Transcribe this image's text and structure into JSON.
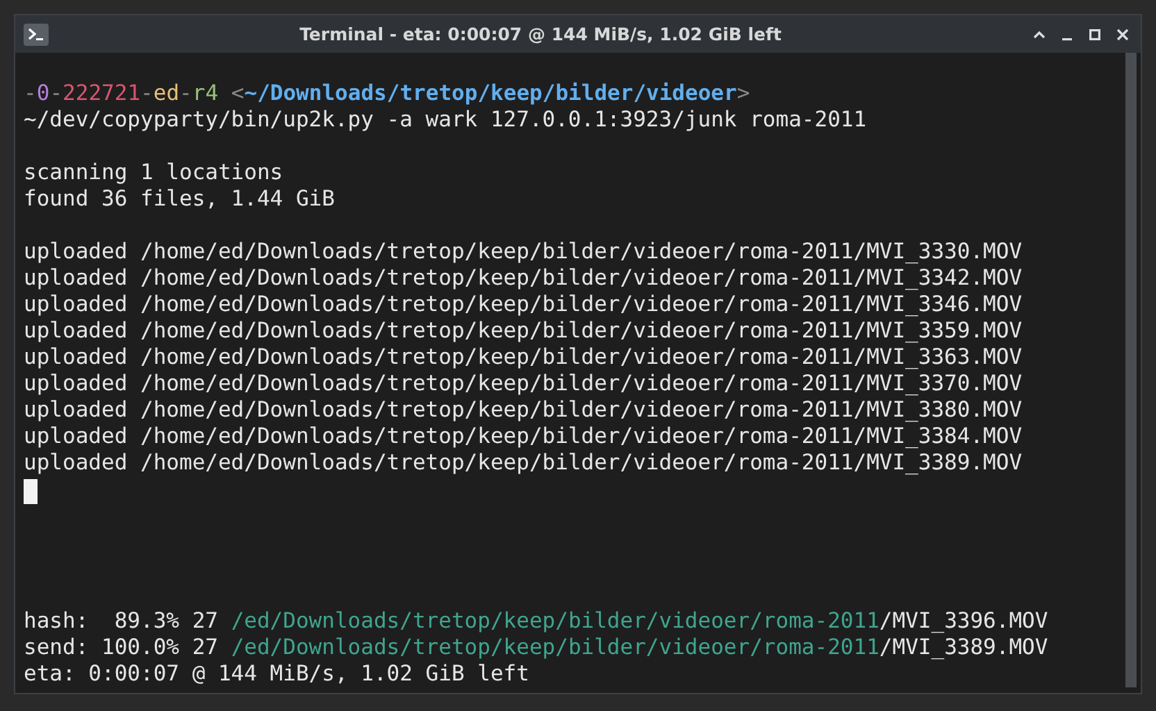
{
  "window": {
    "title": "Terminal - eta: 0:00:07 @ 144 MiB/s, 1.02 GiB left"
  },
  "blocks": [
    [
      [
        {
          "text": "-",
          "color": "#8a8a8a"
        },
        {
          "text": "0",
          "color": "#b57edc"
        },
        {
          "text": "-",
          "color": "#8a8a8a"
        },
        {
          "text": "222721",
          "color": "#d9566e"
        },
        {
          "text": "-",
          "color": "#8a8a8a"
        },
        {
          "text": "ed",
          "color": "#e5c07b"
        },
        {
          "text": "-",
          "color": "#8a8a8a"
        },
        {
          "text": "r4",
          "color": "#98c379"
        },
        {
          "text": " <",
          "color": "#8a8a8a"
        },
        {
          "text": "~/Downloads/tretop/keep/bilder/videoer",
          "color": "#61afef"
        },
        {
          "text": ">",
          "color": "#8a8a8a"
        }
      ],
      [
        {
          "text": "~/dev/copyparty/bin/up2k.py -a wark 127.0.0.1:3923/junk roma-2011",
          "color": "#e6e6e6"
        }
      ]
    ],
    [
      [
        {
          "text": "scanning 1 locations",
          "color": "#e6e6e6"
        }
      ],
      [
        {
          "text": "found 36 files, 1.44 GiB",
          "color": "#e6e6e6"
        }
      ]
    ],
    [
      [
        {
          "text": "uploaded /home/ed/Downloads/tretop/keep/bilder/videoer/roma-2011/MVI_3330.MOV",
          "color": "#e6e6e6"
        }
      ],
      [
        {
          "text": "uploaded /home/ed/Downloads/tretop/keep/bilder/videoer/roma-2011/MVI_3342.MOV",
          "color": "#e6e6e6"
        }
      ],
      [
        {
          "text": "uploaded /home/ed/Downloads/tretop/keep/bilder/videoer/roma-2011/MVI_3346.MOV",
          "color": "#e6e6e6"
        }
      ],
      [
        {
          "text": "uploaded /home/ed/Downloads/tretop/keep/bilder/videoer/roma-2011/MVI_3359.MOV",
          "color": "#e6e6e6"
        }
      ],
      [
        {
          "text": "uploaded /home/ed/Downloads/tretop/keep/bilder/videoer/roma-2011/MVI_3363.MOV",
          "color": "#e6e6e6"
        }
      ],
      [
        {
          "text": "uploaded /home/ed/Downloads/tretop/keep/bilder/videoer/roma-2011/MVI_3370.MOV",
          "color": "#e6e6e6"
        }
      ],
      [
        {
          "text": "uploaded /home/ed/Downloads/tretop/keep/bilder/videoer/roma-2011/MVI_3380.MOV",
          "color": "#e6e6e6"
        }
      ],
      [
        {
          "text": "uploaded /home/ed/Downloads/tretop/keep/bilder/videoer/roma-2011/MVI_3384.MOV",
          "color": "#e6e6e6"
        }
      ],
      [
        {
          "text": "uploaded /home/ed/Downloads/tretop/keep/bilder/videoer/roma-2011/MVI_3389.MOV",
          "color": "#e6e6e6"
        }
      ]
    ]
  ],
  "status_lines": [
    [
      {
        "text": "hash:  89.3% 27 ",
        "color": "#e6e6e6"
      },
      {
        "text": "/ed/Downloads/tretop/keep/bilder/videoer/roma-2011",
        "color": "#3fa58f"
      },
      {
        "text": "/MVI_3396.MOV",
        "color": "#e6e6e6"
      }
    ],
    [
      {
        "text": "send: 100.0% 27 ",
        "color": "#e6e6e6"
      },
      {
        "text": "/ed/Downloads/tretop/keep/bilder/videoer/roma-2011",
        "color": "#3fa58f"
      },
      {
        "text": "/MVI_3389.MOV",
        "color": "#e6e6e6"
      }
    ],
    [
      {
        "text": "eta: 0:00:07 @ 144 MiB/s, 1.02 GiB left",
        "color": "#e6e6e6"
      }
    ]
  ]
}
